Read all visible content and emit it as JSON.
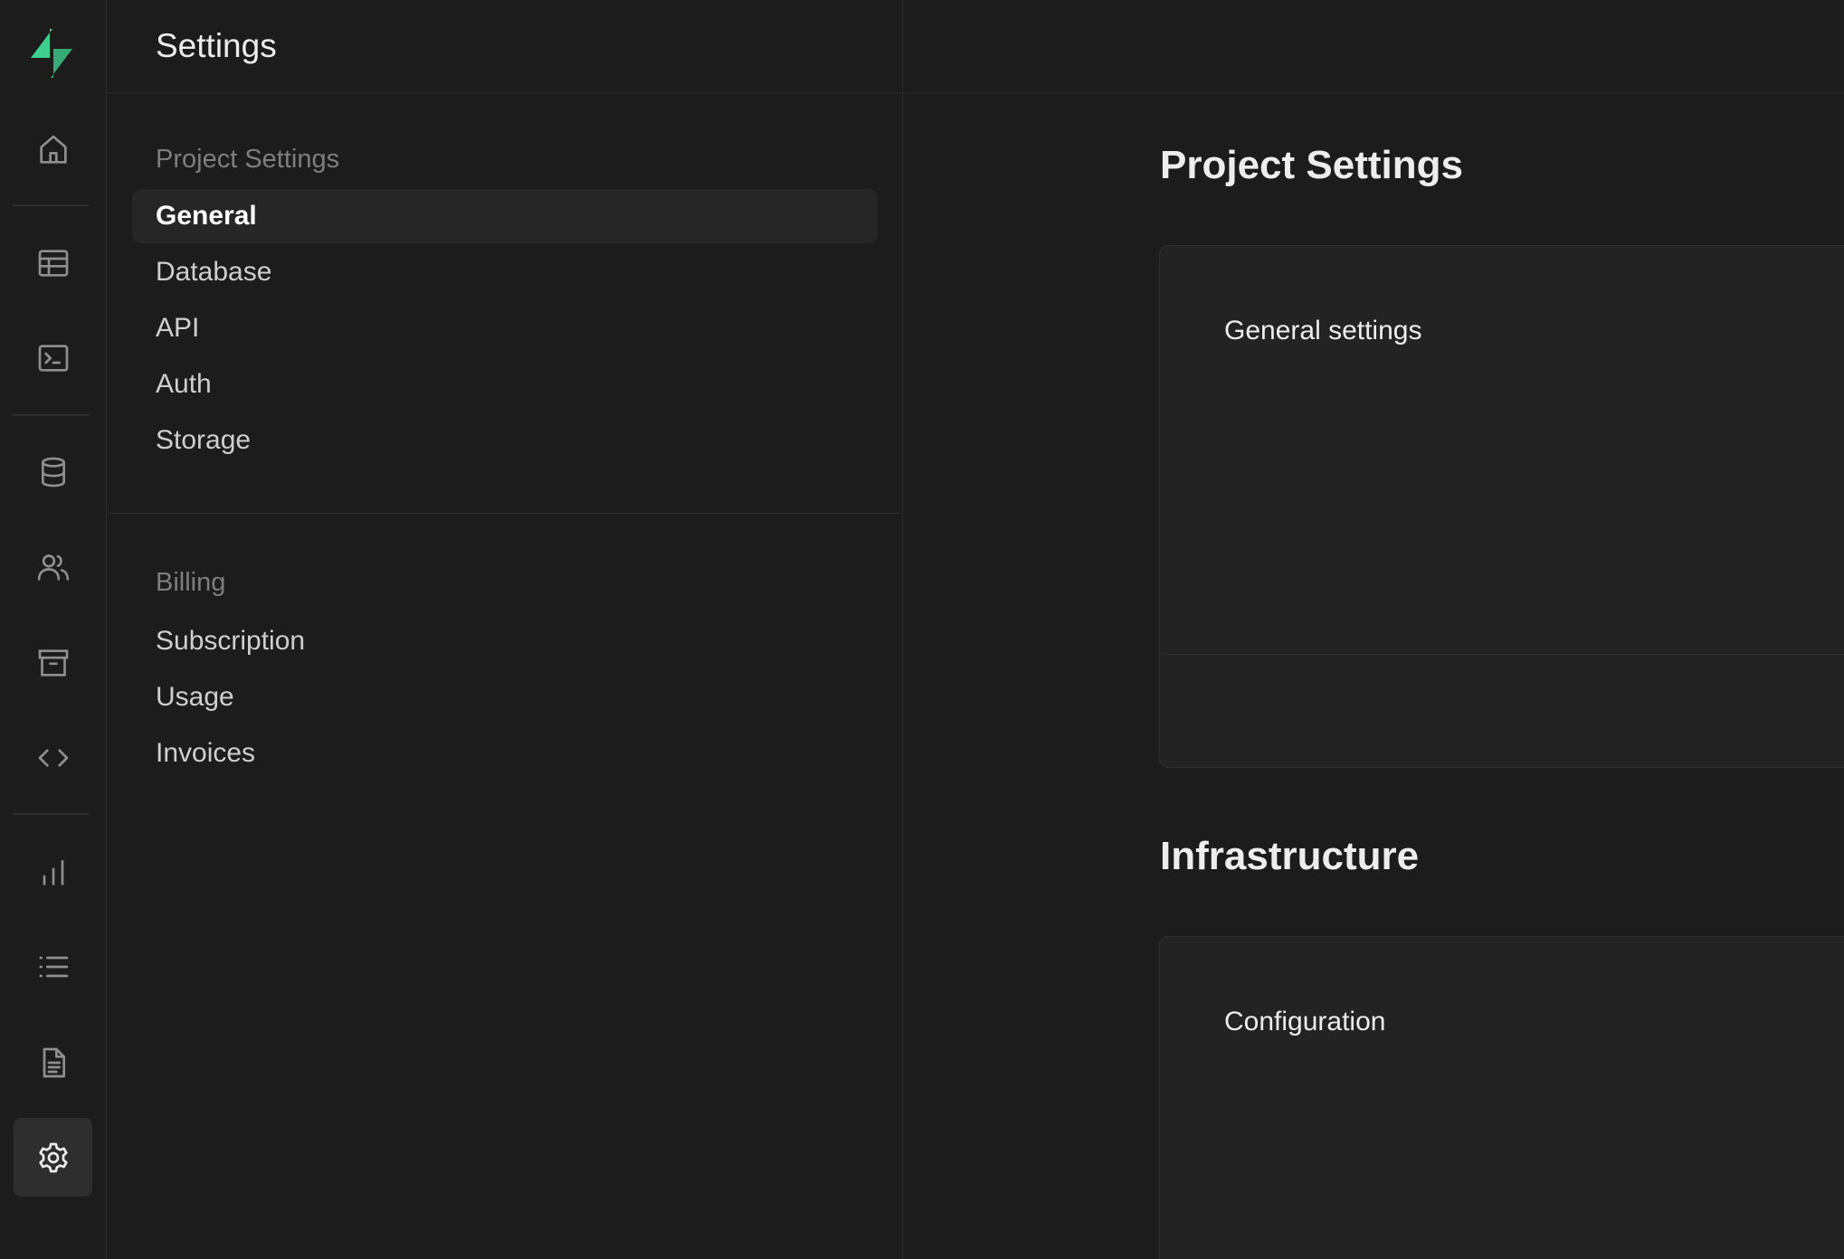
{
  "app": {
    "accent": "#3ecf8e"
  },
  "rail": {
    "items": [
      {
        "name": "home-icon"
      },
      {
        "name": "table-editor-icon"
      },
      {
        "name": "sql-editor-icon"
      },
      {
        "name": "database-icon"
      },
      {
        "name": "users-icon"
      },
      {
        "name": "storage-icon"
      },
      {
        "name": "code-icon"
      },
      {
        "name": "reports-icon"
      },
      {
        "name": "logs-icon"
      },
      {
        "name": "docs-icon"
      },
      {
        "name": "settings-icon",
        "active": true
      }
    ]
  },
  "menu": {
    "title": "Settings",
    "groups": [
      {
        "title": "Project Settings",
        "items": [
          {
            "label": "General",
            "active": true
          },
          {
            "label": "Database"
          },
          {
            "label": "API"
          },
          {
            "label": "Auth"
          },
          {
            "label": "Storage"
          }
        ]
      },
      {
        "title": "Billing",
        "items": [
          {
            "label": "Subscription"
          },
          {
            "label": "Usage"
          },
          {
            "label": "Invoices"
          }
        ]
      }
    ]
  },
  "main": {
    "sections": [
      {
        "title": "Project Settings",
        "card_title": "General settings"
      },
      {
        "title": "Infrastructure",
        "card_title": "Configuration"
      }
    ]
  }
}
